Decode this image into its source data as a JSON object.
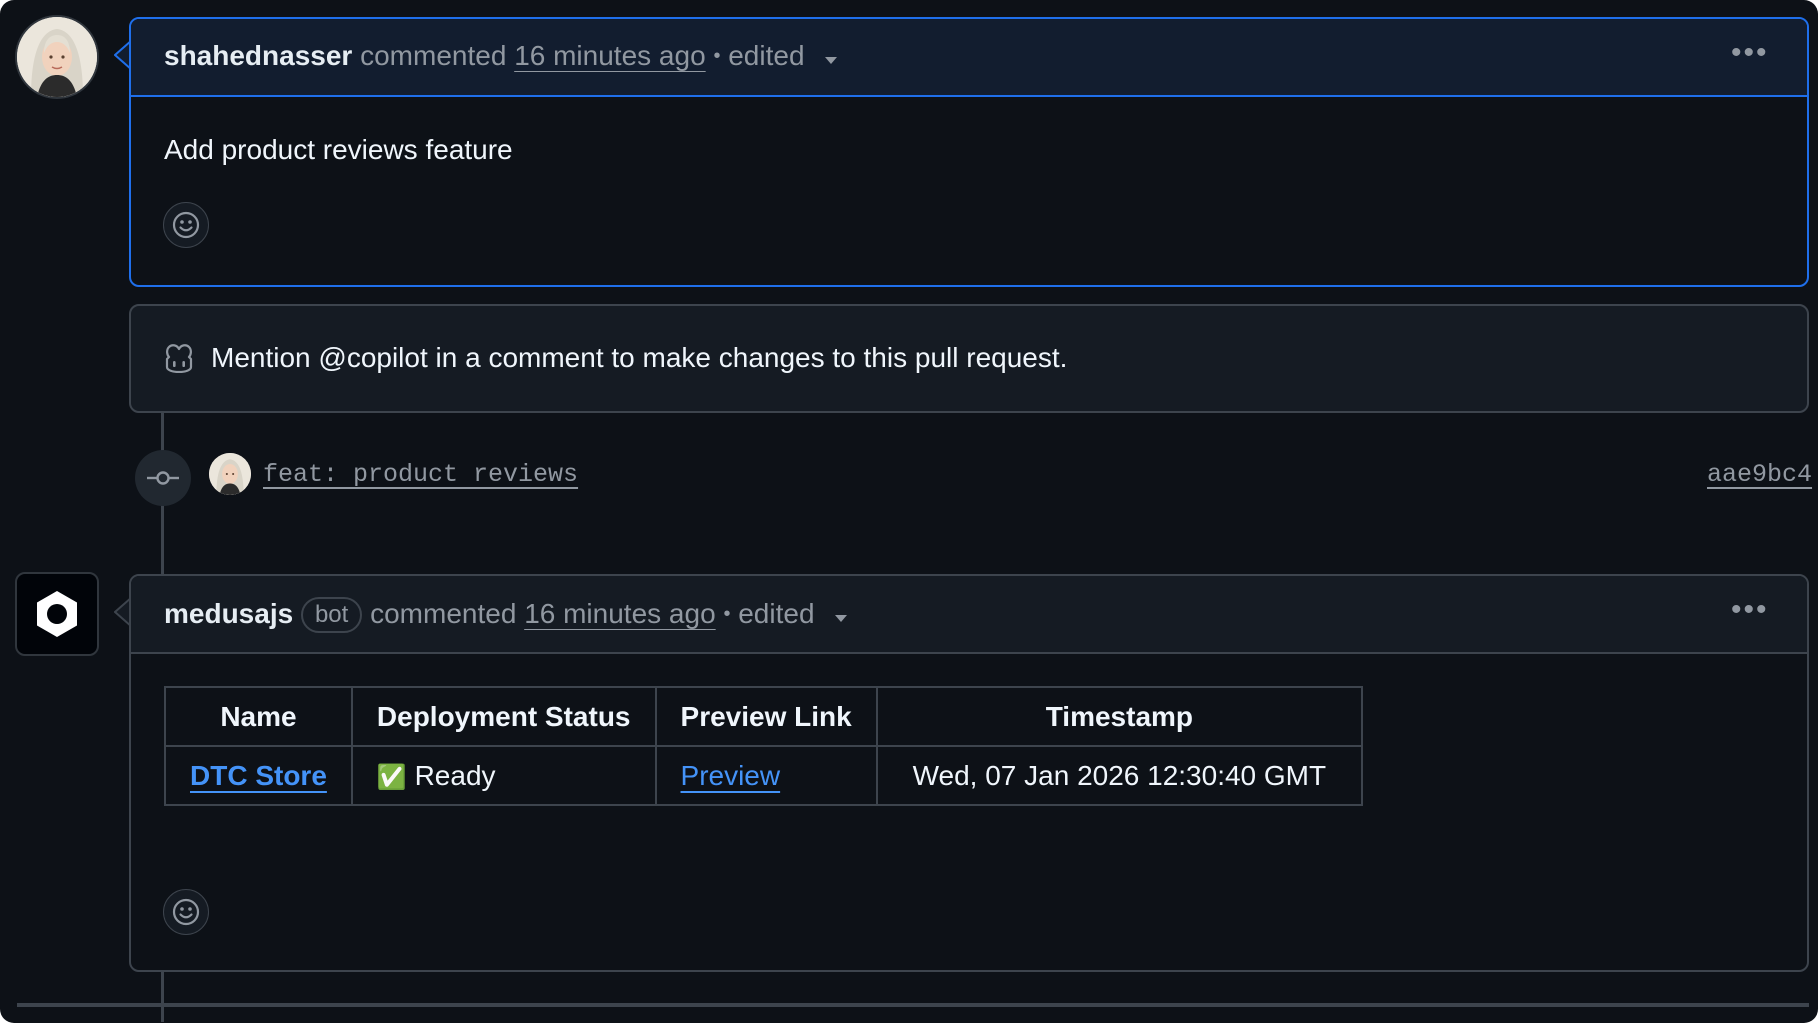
{
  "comments": [
    {
      "author": "shahednasser",
      "action": "commented",
      "time": "16 minutes ago",
      "separator": "•",
      "edited": "edited",
      "body": "Add product reviews feature"
    },
    {
      "author": "medusajs",
      "badge": "bot",
      "action": "commented",
      "time": "16 minutes ago",
      "separator": "•",
      "edited": "edited"
    }
  ],
  "copilot_notice": "Mention @copilot in a comment to make changes to this pull request.",
  "commit": {
    "message": "feat: product reviews",
    "sha": "aae9bc4"
  },
  "deploy_table": {
    "headers": [
      "Name",
      "Deployment Status",
      "Preview Link",
      "Timestamp"
    ],
    "row": {
      "name": "DTC Store",
      "status_icon": "✅",
      "status": "Ready",
      "preview": "Preview",
      "timestamp": "Wed, 07 Jan 2026 12:30:40 GMT"
    }
  },
  "icons": {
    "more": "kebab-horizontal-icon",
    "react": "smiley-icon",
    "copilot": "copilot-icon",
    "commit": "git-commit-icon",
    "caret": "triangle-down-icon"
  },
  "colors": {
    "background": "#0d1117",
    "header_active": "#121d2f",
    "header": "#151b23",
    "border": "#3d444d",
    "active_border": "#1f6feb",
    "link": "#4493f8",
    "muted": "#9198a1",
    "text": "#e6edf3"
  }
}
